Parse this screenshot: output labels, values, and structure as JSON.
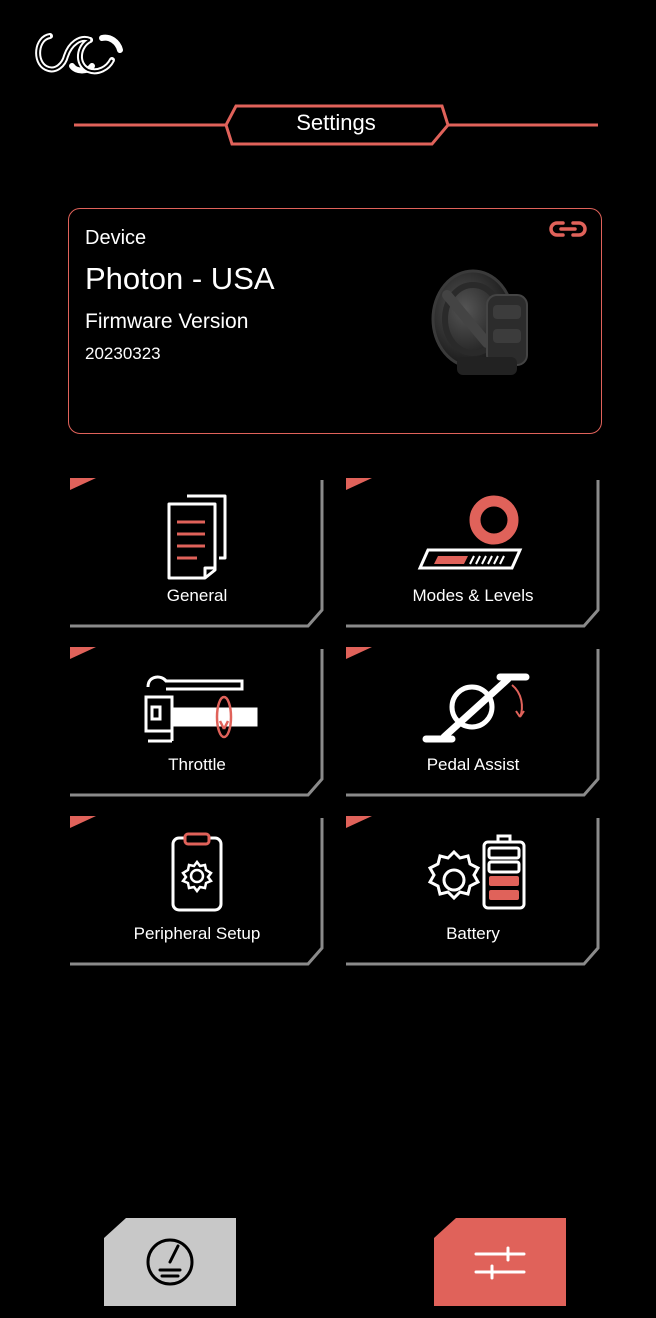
{
  "app": {
    "logo_icon": "cyc-logo-icon"
  },
  "header": {
    "title": "Settings"
  },
  "device": {
    "label": "Device",
    "name": "Photon - USA",
    "firmware_label": "Firmware Version",
    "firmware_value": "20230323",
    "link_icon": "link-icon",
    "image": "motor-image"
  },
  "tiles": [
    {
      "label": "General",
      "icon": "documents-icon"
    },
    {
      "label": "Modes & Levels",
      "icon": "modes-levels-icon"
    },
    {
      "label": "Throttle",
      "icon": "throttle-icon"
    },
    {
      "label": "Pedal Assist",
      "icon": "pedal-assist-icon"
    },
    {
      "label": "Peripheral Setup",
      "icon": "peripheral-icon"
    },
    {
      "label": "Battery",
      "icon": "battery-gear-icon"
    }
  ],
  "bottom_nav": [
    {
      "name": "dashboard",
      "icon": "speedometer-icon",
      "active": false
    },
    {
      "name": "settings",
      "icon": "sliders-icon",
      "active": true
    }
  ],
  "colors": {
    "accent": "#e0625a",
    "background": "#000000",
    "frame": "#8a8a8a",
    "nav_inactive": "#c8c8c8"
  }
}
